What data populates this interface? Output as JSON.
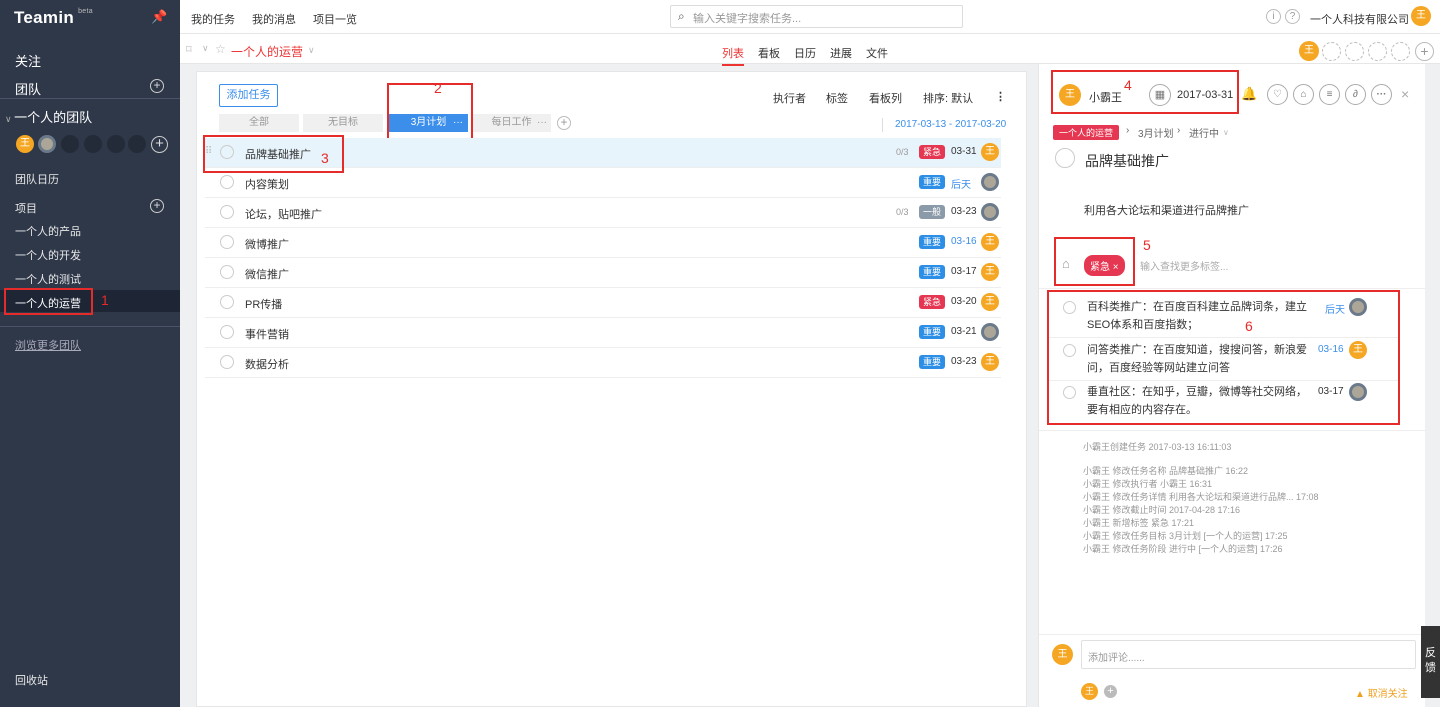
{
  "app": {
    "logo": "Teamin",
    "beta": "beta"
  },
  "sidebar": {
    "follow": "关注",
    "team": "团队",
    "team_name": "一个人的团队",
    "team_calendar": "团队日历",
    "projects_label": "项目",
    "projects": [
      "一个人的产品",
      "一个人的开发",
      "一个人的测试",
      "一个人的运营"
    ],
    "more_teams": "浏览更多团队",
    "recycle": "回收站",
    "member_avatar": "王"
  },
  "topbar": {
    "my_tasks": "我的任务",
    "my_messages": "我的消息",
    "projects_overview": "项目一览",
    "search_placeholder": "输入关键字搜索任务...",
    "company": "一个人科技有限公司",
    "user_avatar": "王"
  },
  "project_bar": {
    "title": "一个人的运营",
    "views": [
      "列表",
      "看板",
      "日历",
      "进展",
      "文件"
    ],
    "active_view": "列表"
  },
  "toolbar": {
    "add_task": "添加任务",
    "filters": [
      "执行者",
      "标签",
      "看板列",
      "排序: 默认"
    ],
    "tabs": [
      "全部",
      "无目标",
      "3月计划",
      "每日工作"
    ],
    "tab_more": "···",
    "date_range": "2017-03-13 - 2017-03-20"
  },
  "tasks": [
    {
      "name": "品牌基础推广",
      "sub": "0/3",
      "tag": "紧急",
      "due": "03-31",
      "assignee": "王"
    },
    {
      "name": "内容策划",
      "sub": "",
      "tag": "重要",
      "due": "后天",
      "assignee": ""
    },
    {
      "name": "论坛，贴吧推广",
      "sub": "0/3",
      "tag": "一般",
      "due": "03-23",
      "assignee": ""
    },
    {
      "name": "微博推广",
      "sub": "",
      "tag": "重要",
      "due": "03-16",
      "assignee": "王"
    },
    {
      "name": "微信推广",
      "sub": "",
      "tag": "重要",
      "due": "03-17",
      "assignee": "王"
    },
    {
      "name": "PR传播",
      "sub": "",
      "tag": "紧急",
      "due": "03-20",
      "assignee": "王"
    },
    {
      "name": "事件营销",
      "sub": "",
      "tag": "重要",
      "due": "03-21",
      "assignee": ""
    },
    {
      "name": "数据分析",
      "sub": "",
      "tag": "重要",
      "due": "03-23",
      "assignee": "王"
    }
  ],
  "detail": {
    "assignee": "小霸王",
    "assignee_avatar": "王",
    "due_date": "2017-03-31",
    "breadcrumb": [
      "一个人的运营",
      "3月计划",
      "进行中"
    ],
    "title": "品牌基础推广",
    "description": "利用各大论坛和渠道进行品牌推广",
    "tag": "紧急 ×",
    "tag_placeholder": "输入查找更多标签...",
    "subtasks": [
      {
        "text": "百科类推广：在百度百科建立品牌词条，建立SEO体系和百度指数；",
        "due": "后天"
      },
      {
        "text": "问答类推广：在百度知道，搜搜问答，新浪爱问，百度经验等网站建立问答",
        "due": "03-16"
      },
      {
        "text": "垂直社区：在知乎，豆瓣，微博等社交网络，要有相应的内容存在。",
        "due": "03-17"
      }
    ],
    "created": "小霸王创建任务  2017-03-13 16:11:03",
    "logs": [
      "小霸王 修改任务名称 品牌基础推广    16:22",
      "小霸王 修改执行者 小霸王    16:31",
      "小霸王 修改任务详情 利用各大论坛和渠道进行品牌...       17:08",
      "小霸王 修改截止时间 2017-04-28    17:16",
      "小霸王 新增标签 紧急    17:21",
      "小霸王 修改任务目标 3月计划 [一个人的运营]    17:25",
      "小霸王 修改任务阶段 进行中 [一个人的运营]    17:26"
    ],
    "comment_placeholder": "添加评论......",
    "unfollow": "取消关注"
  },
  "feedback": "反馈",
  "annotations": [
    "1",
    "2",
    "3",
    "4",
    "5",
    "6"
  ]
}
